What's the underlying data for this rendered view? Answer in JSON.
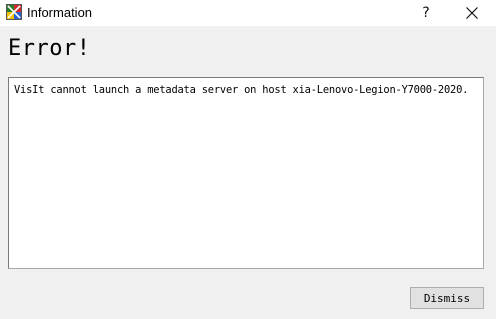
{
  "window": {
    "title": "Information",
    "help_glyph": "?",
    "close_icon": "close-icon",
    "app_icon": "visit-app-icon"
  },
  "dialog": {
    "heading": "Error!",
    "message": "VisIt cannot launch a metadata server on host xia-Lenovo-Legion-Y7000-2020.",
    "dismiss_label": "Dismiss"
  }
}
